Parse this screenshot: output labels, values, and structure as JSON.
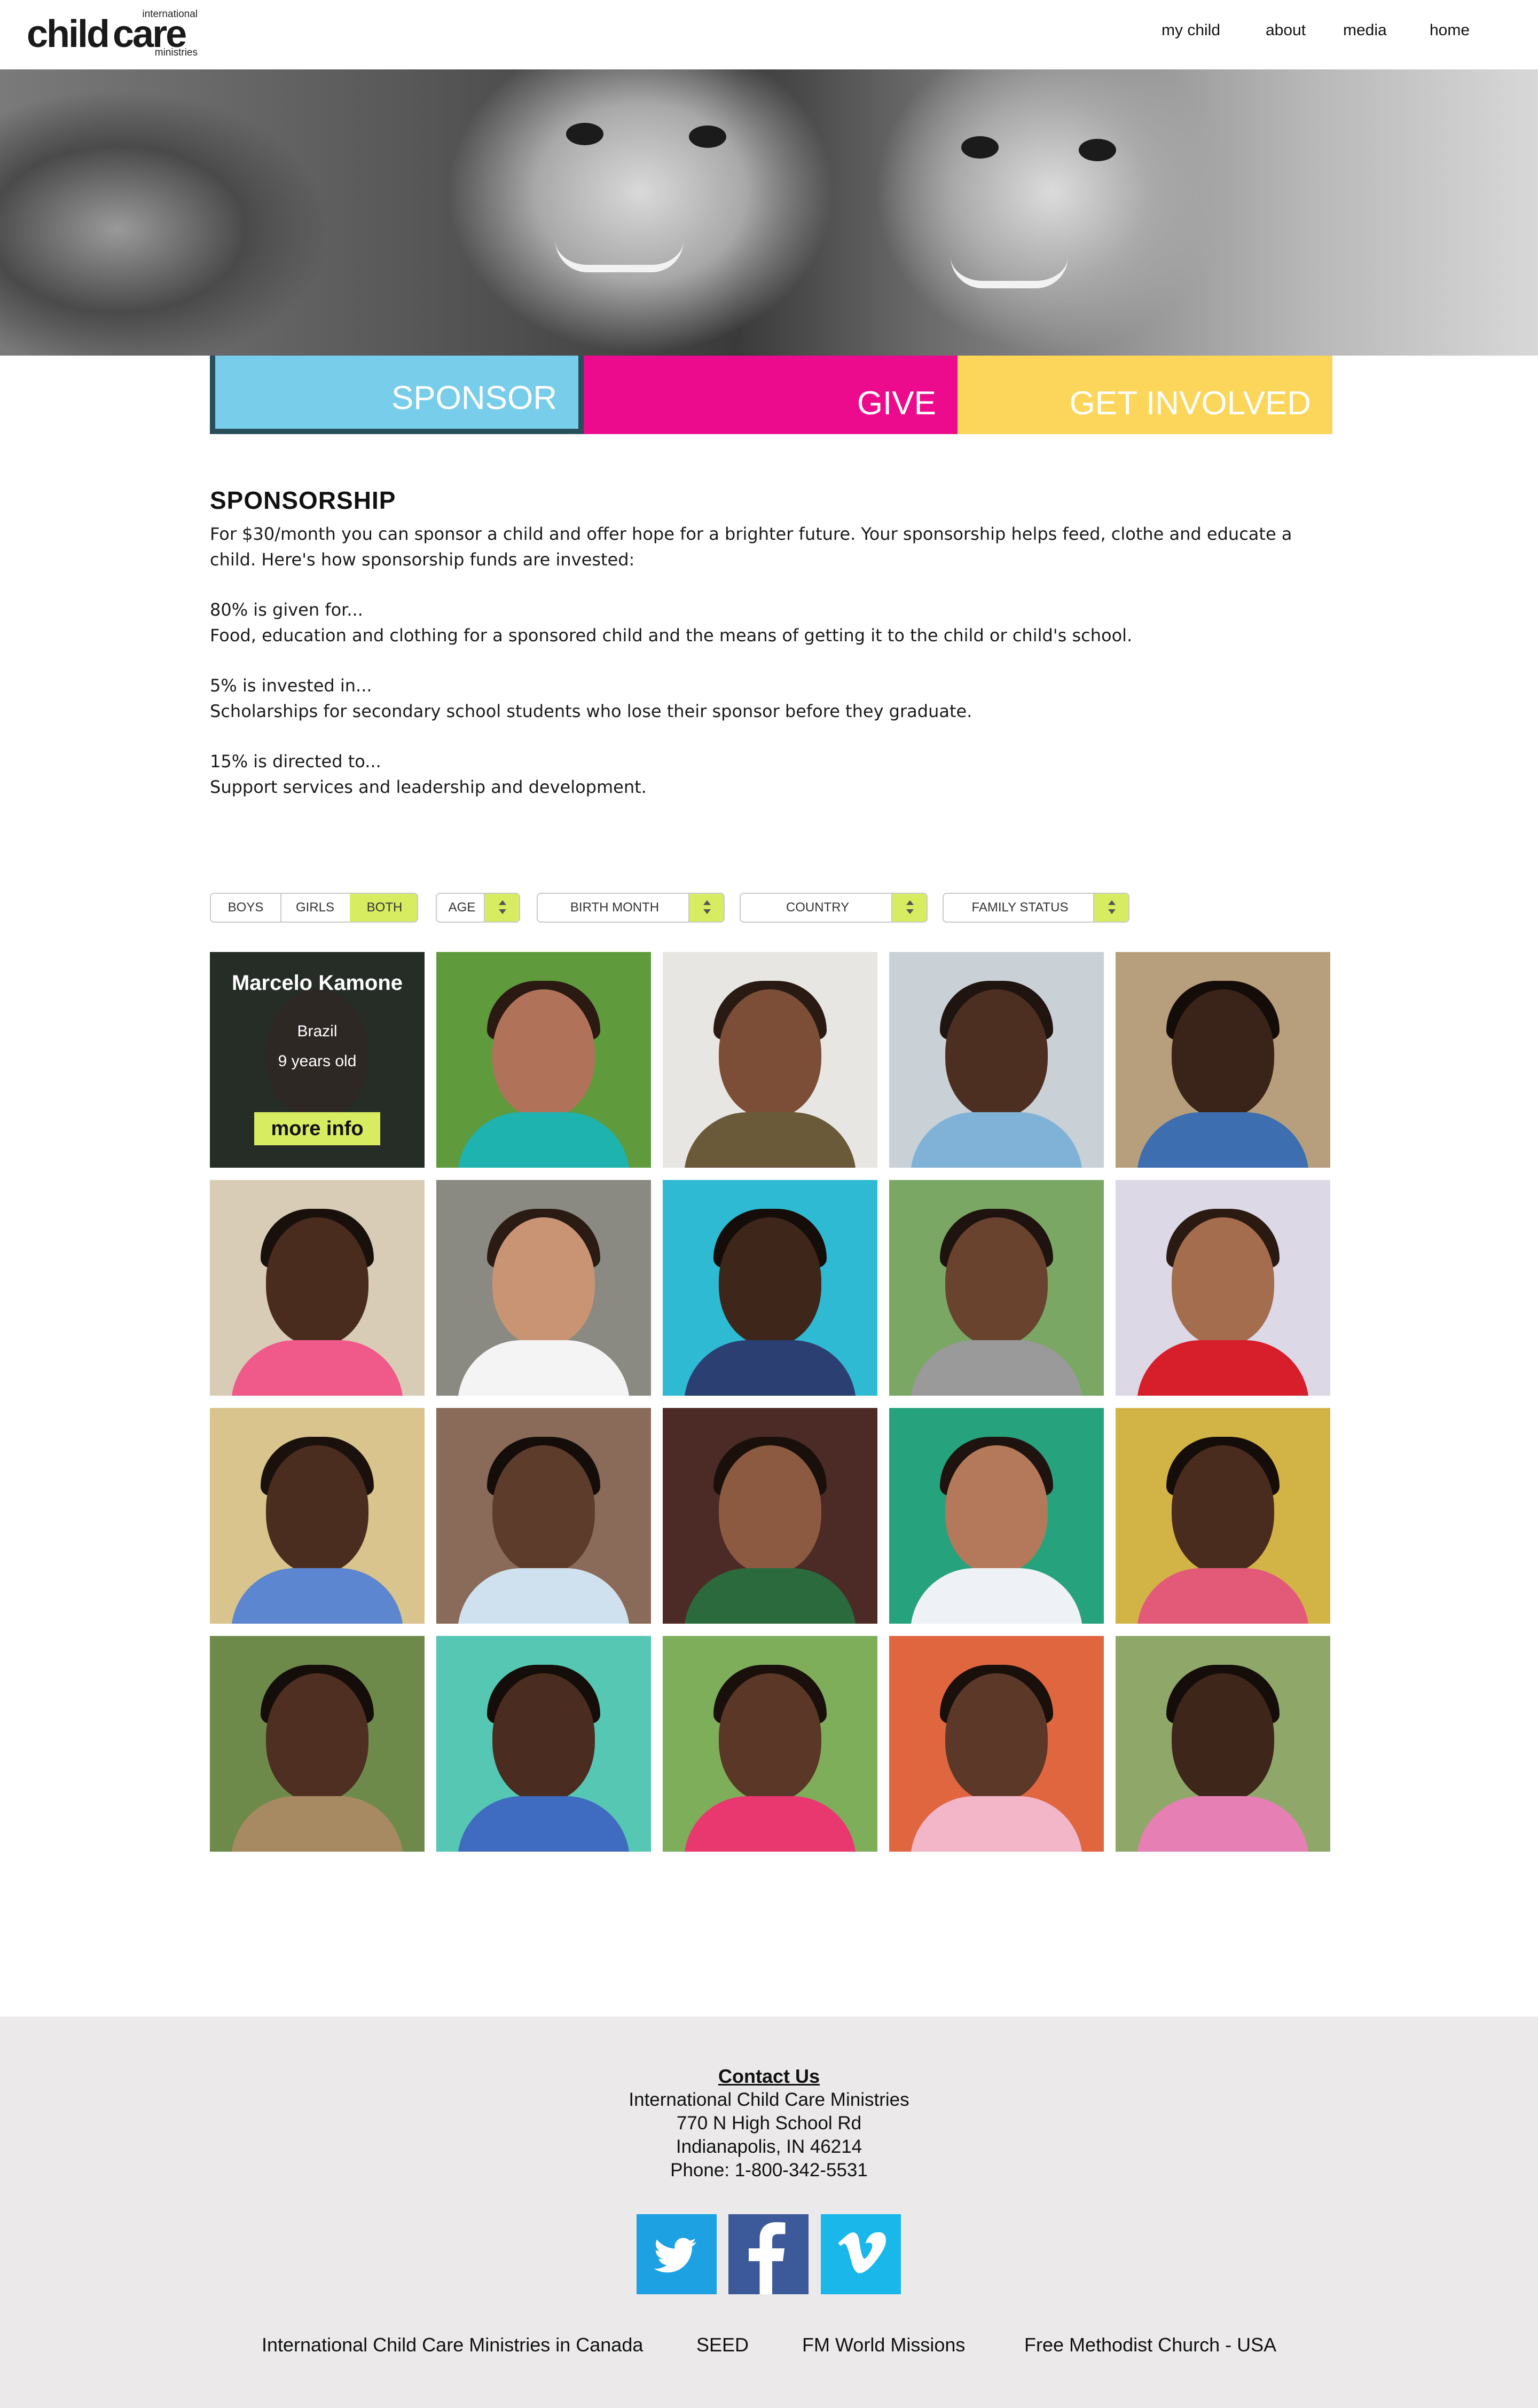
{
  "header": {
    "logo": {
      "top": "international",
      "main_child": "child",
      "main_care": "care",
      "bottom": "ministries"
    },
    "nav": [
      "my child",
      "about",
      "media",
      "home"
    ]
  },
  "tabs": [
    {
      "label": "SPONSOR",
      "color": "#77cdea"
    },
    {
      "label": "GIVE",
      "color": "#ec0b8c"
    },
    {
      "label": "GET INVOLVED",
      "color": "#fcd65a"
    }
  ],
  "sponsorship": {
    "title": "SPONSORSHIP",
    "intro": "For $30/month you can sponsor a child and offer hope for a brighter future. Your  sponsorship helps feed, clothe and educate a child. Here's how sponsorship funds are invested:",
    "p1_head": "80% is given for...",
    "p1_body": "Food, education and clothing for a sponsored child and the means of getting it to the child or child's school.",
    "p2_head": "5% is invested in...",
    "p2_body": "Scholarships for secondary school students who lose their sponsor before they graduate.",
    "p3_head": "15% is directed to...",
    "p3_body": "Support services and leadership and development."
  },
  "filters": {
    "gender": [
      "BOYS",
      "GIRLS",
      "BOTH"
    ],
    "gender_selected": "BOTH",
    "age": "AGE",
    "birth_month": "BIRTH MONTH",
    "country": "COUNTRY",
    "family_status": "FAMILY STATUS",
    "accent": "#d8ec62"
  },
  "featured": {
    "name": "Marcelo Kamone",
    "country": "Brazil",
    "age": "9 years old",
    "button": "more info"
  },
  "footer": {
    "contact_title": "Contact Us",
    "org": "International Child Care Ministries",
    "street": "770 N High School Rd",
    "city": "Indianapolis, IN 46214",
    "phone": "Phone: 1-800-342-5531",
    "social": [
      "twitter-icon",
      "facebook-icon",
      "vimeo-icon"
    ],
    "links": [
      "International Child Care Ministries in Canada",
      "SEED",
      "FM World Missions",
      "Free Methodist Church - USA"
    ]
  }
}
